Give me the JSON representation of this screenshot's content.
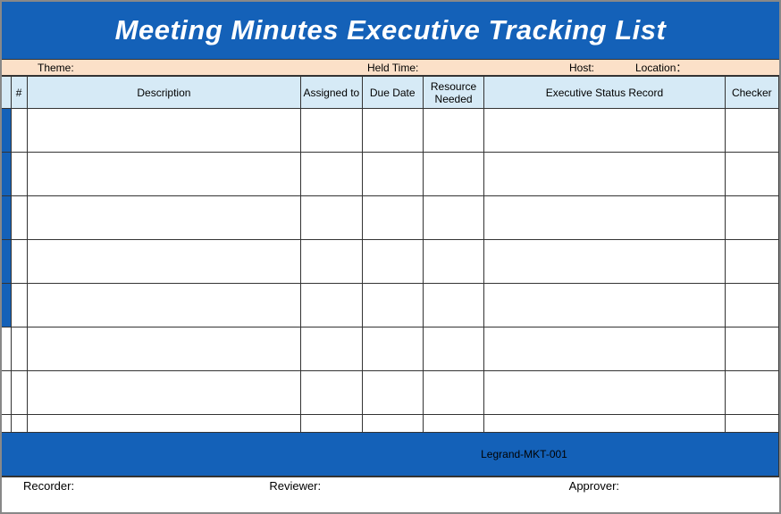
{
  "title": "Meeting Minutes Executive Tracking List",
  "info": {
    "theme_label": "Theme:",
    "held_label": "Held Time:",
    "host_label": "Host:",
    "location_label": "Location："
  },
  "columns": {
    "hash": "#",
    "description": "Description",
    "assigned": "Assigned to",
    "due": "Due Date",
    "resource": "Resource Needed",
    "status": "Executive Status Record",
    "checker": "Checker"
  },
  "doc_id": "Legrand-MKT-001",
  "signatures": {
    "recorder": "Recorder:",
    "reviewer": "Reviewer:",
    "approver": "Approver:"
  }
}
